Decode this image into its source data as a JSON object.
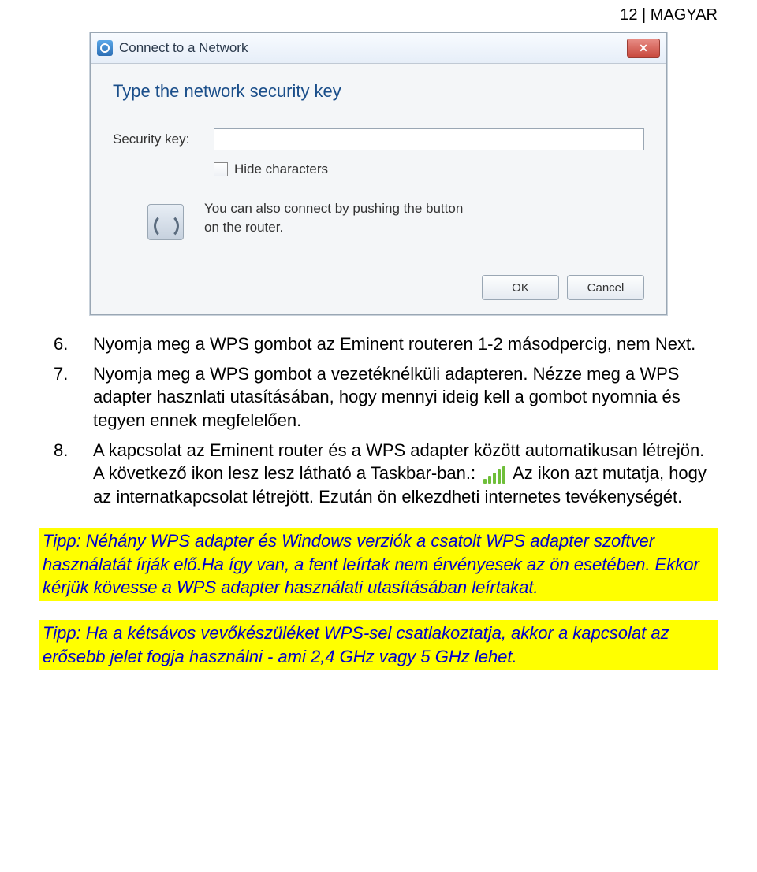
{
  "header": {
    "page_label": "12 | MAGYAR"
  },
  "dialog": {
    "title": "Connect to a Network",
    "heading": "Type the network security key",
    "security_key_label": "Security key:",
    "security_key_value": "",
    "hide_chars_label": "Hide characters",
    "wps_hint": "You can also connect by pushing the button on the router.",
    "ok_label": "OK",
    "cancel_label": "Cancel"
  },
  "steps": {
    "s6_num": "6.",
    "s6_text": "Nyomja meg a WPS gombot  az Eminent routeren 1-2 másodpercig, nem Next.",
    "s7_num": "7.",
    "s7_text": "Nyomja meg a WPS gombot a vezetéknélküli adapteren. Nézze meg a WPS adapter hasznlati utasításában, hogy mennyi ideig kell a gombot nyomnia és tegyen ennek megfelelően.",
    "s8_num": "8.",
    "s8_text_a": "A kapcsolat az Eminent router és a WPS adapter között automatikusan létrejön. A következő ikon lesz lesz látható a Taskbar-ban.: ",
    "s8_text_b": " Az ikon azt mutatja, hogy az internatkapcsolat létrejött. Ezután ön elkezdheti internetes tevékenységét."
  },
  "tips": {
    "tip1": "Tipp: Néhány WPS adapter és Windows verziók a csatolt WPS adapter szoftver használatát írják elő.Ha így van, a fent leírtak nem érvényesek az ön esetében. Ekkor kérjük kövesse a WPS adapter használati utasításában leírtakat.",
    "tip2": "Tipp: Ha a kétsávos vevőkészüléket WPS-sel csatlakoztatja, akkor a kapcsolat az erősebb jelet fogja használni - ami 2,4 GHz vagy 5 GHz lehet."
  }
}
